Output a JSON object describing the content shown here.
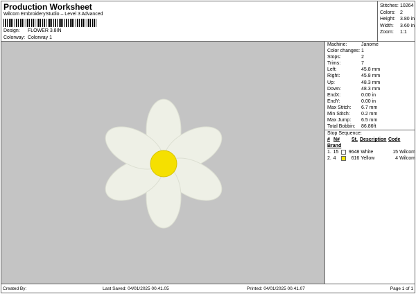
{
  "header": {
    "title": "Production Worksheet",
    "subtitle": "Wilcom EmbroideryStudio – Level 3 Advanced",
    "design_label": "Design:",
    "design": "FLOWER 3.8IN",
    "colorway_label": "Colorway:",
    "colorway": "Colorway 1"
  },
  "stats": [
    {
      "label": "Stitches:",
      "value": "10264"
    },
    {
      "label": "Colors:",
      "value": "2"
    },
    {
      "label": "Height:",
      "value": "3.80 in"
    },
    {
      "label": "Width:",
      "value": "3.60 in"
    },
    {
      "label": "Zoom:",
      "value": "1:1"
    }
  ],
  "info": [
    {
      "label": "Machine:",
      "value": "Janome"
    },
    {
      "label": "Color changes:",
      "value": "1"
    },
    {
      "label": "Stops:",
      "value": "2"
    },
    {
      "label": "Trims:",
      "value": "7"
    },
    {
      "label": "Left:",
      "value": "45.8 mm"
    },
    {
      "label": "Right:",
      "value": "45.8 mm"
    },
    {
      "label": "Up:",
      "value": "48.3 mm"
    },
    {
      "label": "Down:",
      "value": "48.3 mm"
    },
    {
      "label": "EndX:",
      "value": "0.00 in"
    },
    {
      "label": "EndY:",
      "value": "0.00 in"
    },
    {
      "label": "Max Stitch:",
      "value": "6.7 mm"
    },
    {
      "label": "Min Stitch:",
      "value": "0.2 mm"
    },
    {
      "label": "Max Jump:",
      "value": "6.5 mm"
    },
    {
      "label": "Total Bobbin:",
      "value": "86.86ft"
    }
  ],
  "stop_sequence": {
    "title": "Stop Sequence:",
    "headers": [
      "#",
      "N#",
      "St.",
      "Description",
      "Code",
      "Brand"
    ],
    "rows": [
      {
        "idx": "1.",
        "n": "15",
        "color": "#ffffff",
        "st": "9648",
        "desc": "White",
        "code": "15",
        "brand": "Wilcom"
      },
      {
        "idx": "2.",
        "n": "4",
        "color": "#f5e600",
        "st": "616",
        "desc": "Yellow",
        "code": "4",
        "brand": "Wilcom"
      }
    ]
  },
  "footer": {
    "created": "Created By:",
    "saved": "Last Saved: 04/01/2025 00.41.05",
    "printed": "Printed: 04/01/2025 00.41.07",
    "page": "Page 1 of 1"
  },
  "colors": {
    "canvas": "#c4c4c4",
    "petal": "#eef0e6",
    "center": "#f5e000"
  }
}
